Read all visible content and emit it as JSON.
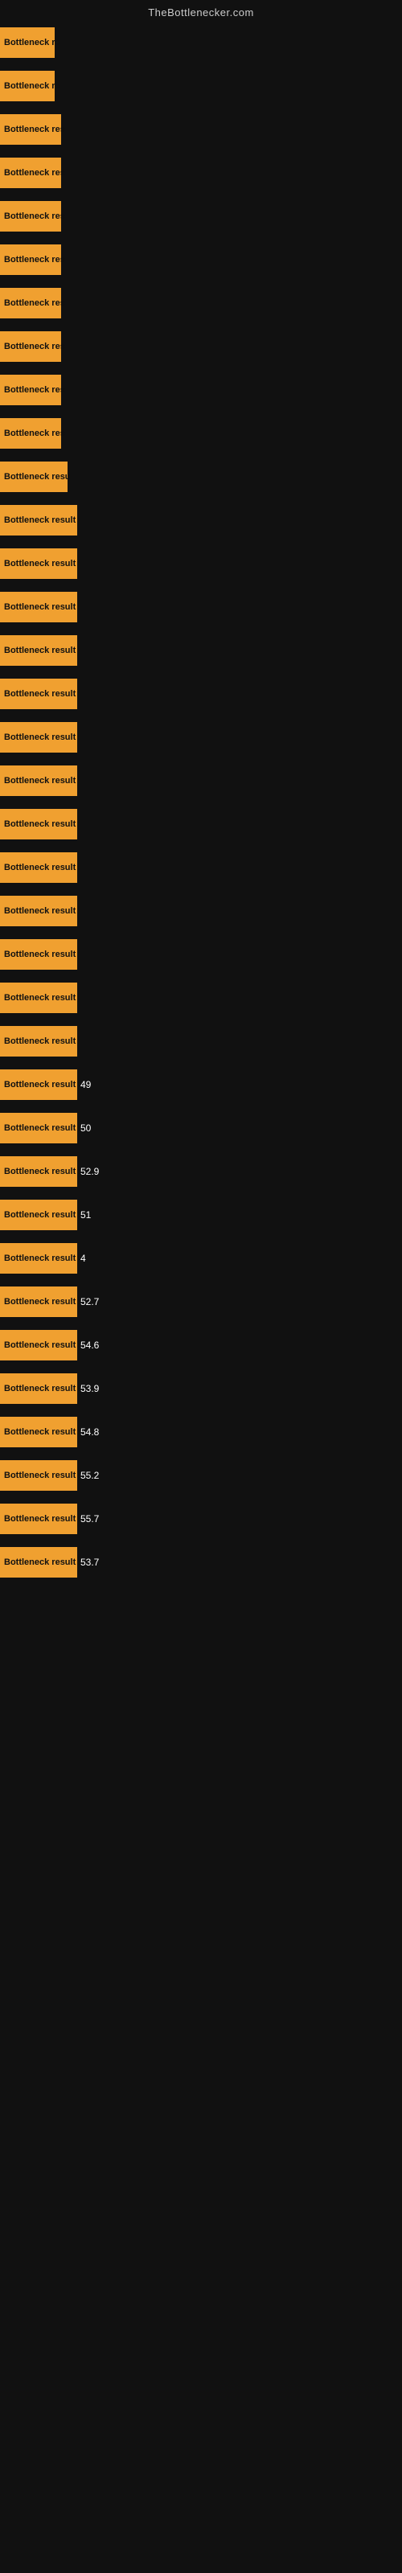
{
  "site": {
    "title": "TheBottlenecker.com"
  },
  "bars": [
    {
      "label": "Bottleneck re",
      "width": 68,
      "value": ""
    },
    {
      "label": "Bottleneck re",
      "width": 68,
      "value": ""
    },
    {
      "label": "Bottleneck res",
      "width": 76,
      "value": ""
    },
    {
      "label": "Bottleneck res",
      "width": 76,
      "value": ""
    },
    {
      "label": "Bottleneck res",
      "width": 76,
      "value": ""
    },
    {
      "label": "Bottleneck res",
      "width": 76,
      "value": ""
    },
    {
      "label": "Bottleneck res",
      "width": 76,
      "value": ""
    },
    {
      "label": "Bottleneck res",
      "width": 76,
      "value": ""
    },
    {
      "label": "Bottleneck res",
      "width": 76,
      "value": ""
    },
    {
      "label": "Bottleneck res",
      "width": 76,
      "value": ""
    },
    {
      "label": "Bottleneck resu",
      "width": 84,
      "value": ""
    },
    {
      "label": "Bottleneck result",
      "width": 96,
      "value": ""
    },
    {
      "label": "Bottleneck result",
      "width": 96,
      "value": ""
    },
    {
      "label": "Bottleneck result",
      "width": 96,
      "value": ""
    },
    {
      "label": "Bottleneck result",
      "width": 96,
      "value": ""
    },
    {
      "label": "Bottleneck result",
      "width": 96,
      "value": ""
    },
    {
      "label": "Bottleneck result",
      "width": 96,
      "value": ""
    },
    {
      "label": "Bottleneck result",
      "width": 96,
      "value": ""
    },
    {
      "label": "Bottleneck result",
      "width": 96,
      "value": ""
    },
    {
      "label": "Bottleneck result",
      "width": 96,
      "value": ""
    },
    {
      "label": "Bottleneck result",
      "width": 96,
      "value": ""
    },
    {
      "label": "Bottleneck result",
      "width": 96,
      "value": ""
    },
    {
      "label": "Bottleneck result",
      "width": 96,
      "value": ""
    },
    {
      "label": "Bottleneck result",
      "width": 96,
      "value": ""
    },
    {
      "label": "Bottleneck result",
      "width": 96,
      "value": "49"
    },
    {
      "label": "Bottleneck result",
      "width": 96,
      "value": "50"
    },
    {
      "label": "Bottleneck result",
      "width": 96,
      "value": "52.9"
    },
    {
      "label": "Bottleneck result",
      "width": 96,
      "value": "51"
    },
    {
      "label": "Bottleneck result",
      "width": 96,
      "value": "4"
    },
    {
      "label": "Bottleneck result",
      "width": 96,
      "value": "52.7"
    },
    {
      "label": "Bottleneck result",
      "width": 96,
      "value": "54.6"
    },
    {
      "label": "Bottleneck result",
      "width": 96,
      "value": "53.9"
    },
    {
      "label": "Bottleneck result",
      "width": 96,
      "value": "54.8"
    },
    {
      "label": "Bottleneck result",
      "width": 96,
      "value": "55.2"
    },
    {
      "label": "Bottleneck result",
      "width": 96,
      "value": "55.7"
    },
    {
      "label": "Bottleneck result",
      "width": 96,
      "value": "53.7"
    }
  ]
}
